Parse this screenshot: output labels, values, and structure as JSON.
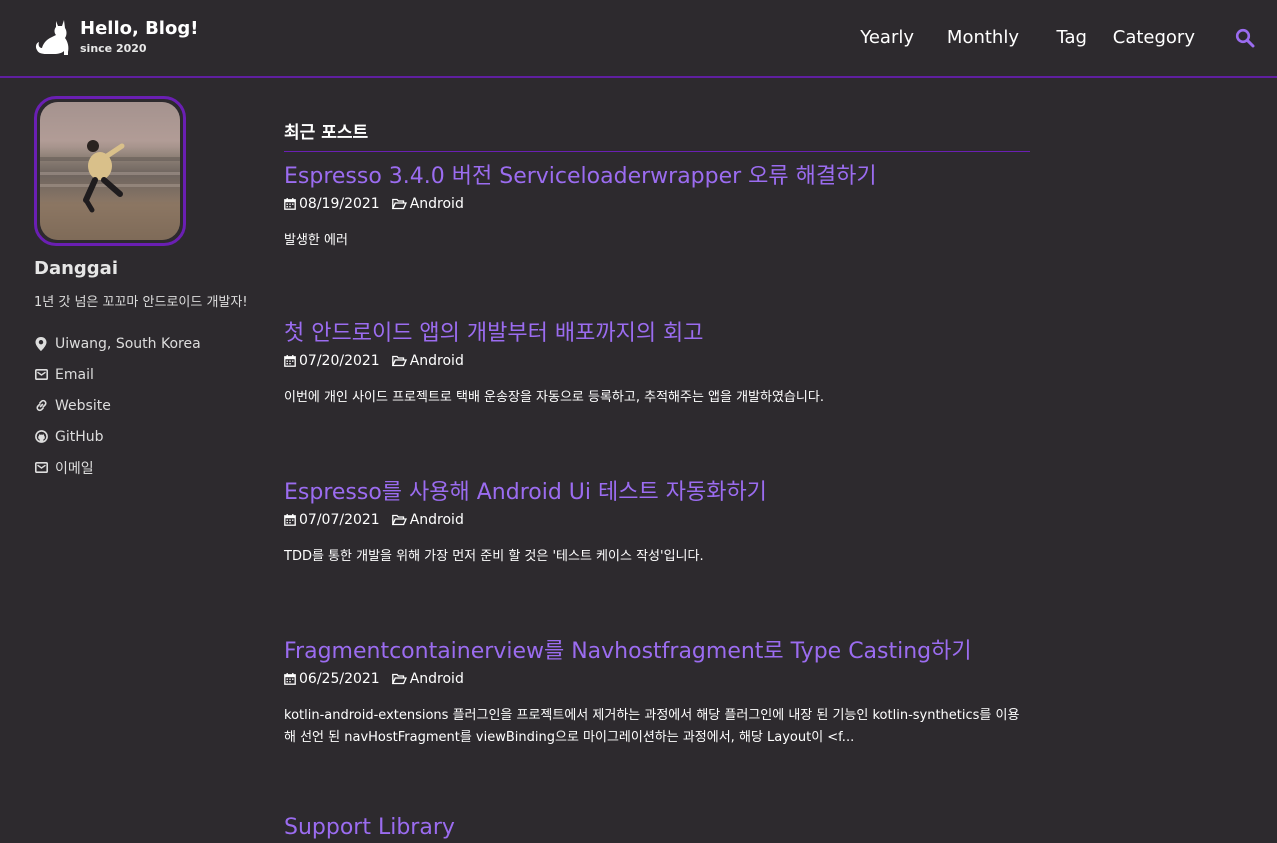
{
  "header": {
    "title": "Hello, Blog!",
    "subtitle": "since 2020",
    "nav": [
      {
        "label": "Yearly"
      },
      {
        "label": "Monthly"
      },
      {
        "label": "Tag"
      },
      {
        "label": "Category"
      }
    ]
  },
  "sidebar": {
    "name": "Danggai",
    "bio": "1년 갓 넘은 꼬꼬마 안드로이드 개발자!",
    "links": [
      {
        "icon": "map-marker-icon",
        "label": "Uiwang, South Korea"
      },
      {
        "icon": "envelope-icon",
        "label": "Email"
      },
      {
        "icon": "link-icon",
        "label": "Website"
      },
      {
        "icon": "github-icon",
        "label": "GitHub"
      },
      {
        "icon": "envelope-icon",
        "label": "이메일"
      }
    ]
  },
  "main": {
    "section_title": "최근 포스트",
    "posts": [
      {
        "title": "Espresso 3.4.0 버전 Serviceloaderwrapper 오류 해결하기",
        "date": "08/19/2021",
        "category": "Android",
        "excerpt": "발생한 에러"
      },
      {
        "title": "첫 안드로이드 앱의 개발부터 배포까지의 회고",
        "date": "07/20/2021",
        "category": "Android",
        "excerpt": "이번에 개인 사이드 프로젝트로 택배 운송장을 자동으로 등록하고, 추적해주는 앱을 개발하였습니다."
      },
      {
        "title": "Espresso를 사용해 Android Ui 테스트 자동화하기",
        "date": "07/07/2021",
        "category": "Android",
        "excerpt": "TDD를 통한 개발을 위해 가장 먼저 준비 할 것은 '테스트 케이스 작성'입니다."
      },
      {
        "title": "Fragmentcontainerview를 Navhostfragment로 Type Casting하기",
        "date": "06/25/2021",
        "category": "Android",
        "excerpt": "kotlin-android-extensions 플러그인을 프로젝트에서 제거하는 과정에서 해당 플러그인에 내장 된 기능인 kotlin-synthetics를 이용해 선언 된 navHostFragment를 viewBinding으로 마이그레이션하는 과정에서, 해당 Layout이 <f..."
      },
      {
        "title": "Support Library"
      }
    ]
  },
  "colors": {
    "background": "#2d2a2e",
    "accent": "#6a1fb3",
    "link": "#9b6cf0"
  }
}
